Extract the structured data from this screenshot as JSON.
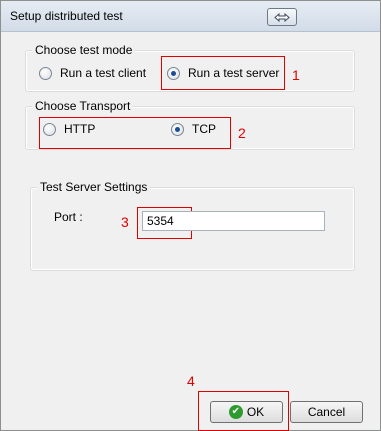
{
  "window": {
    "title": "Setup distributed test"
  },
  "test_mode": {
    "legend": "Choose test mode",
    "options": [
      {
        "label": "Run a test client",
        "checked": false
      },
      {
        "label": "Run a test server",
        "checked": true
      }
    ]
  },
  "transport": {
    "legend": "Choose Transport",
    "options": [
      {
        "label": "HTTP",
        "checked": false
      },
      {
        "label": "TCP",
        "checked": true
      }
    ]
  },
  "server_settings": {
    "legend": "Test Server Settings",
    "port_label": "Port :",
    "port_value": "5354"
  },
  "buttons": {
    "ok": "OK",
    "cancel": "Cancel"
  },
  "annotations": {
    "one": "1",
    "two": "2",
    "three": "3",
    "four": "4"
  },
  "colors": {
    "callout": "#e10000",
    "ok_icon": "#2e9b2e"
  }
}
